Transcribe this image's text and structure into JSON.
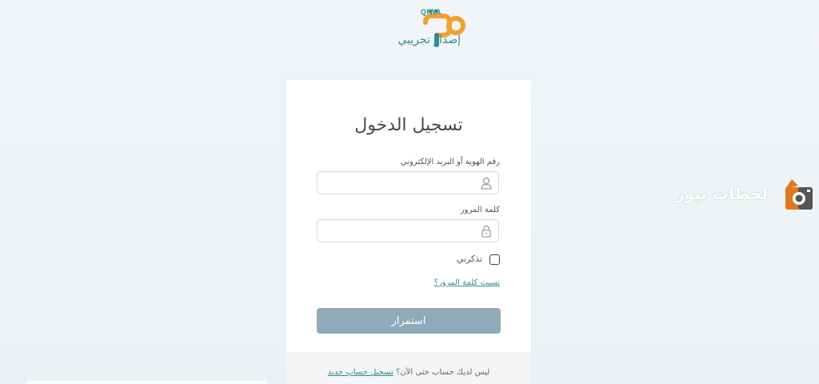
{
  "logo": {
    "latin": "QIWA",
    "subtitle": "إصدار تجريبي",
    "color": "#2e8f8c",
    "accent": "#f0a030"
  },
  "login": {
    "title": "تسجيل الدخول",
    "id_label": "رقم الهوية أو البريد الإلكتروني",
    "id_value": "",
    "id_icon": "user-icon",
    "password_label": "كلمة المرور",
    "password_value": "",
    "password_icon": "lock-icon",
    "remember_label": "تذكرني",
    "remember_checked": false,
    "forgot_link": "نسيت كلمة المرور؟",
    "submit_label": "استمرار",
    "submit_color": "#8fabb9"
  },
  "footer": {
    "question": "ليس لديك حساب حتى الآن؟",
    "register_link": "تسجيل حساب جديد"
  },
  "watermark": {
    "text": "لحظات نيوز",
    "icon": "camera-logo-icon"
  }
}
